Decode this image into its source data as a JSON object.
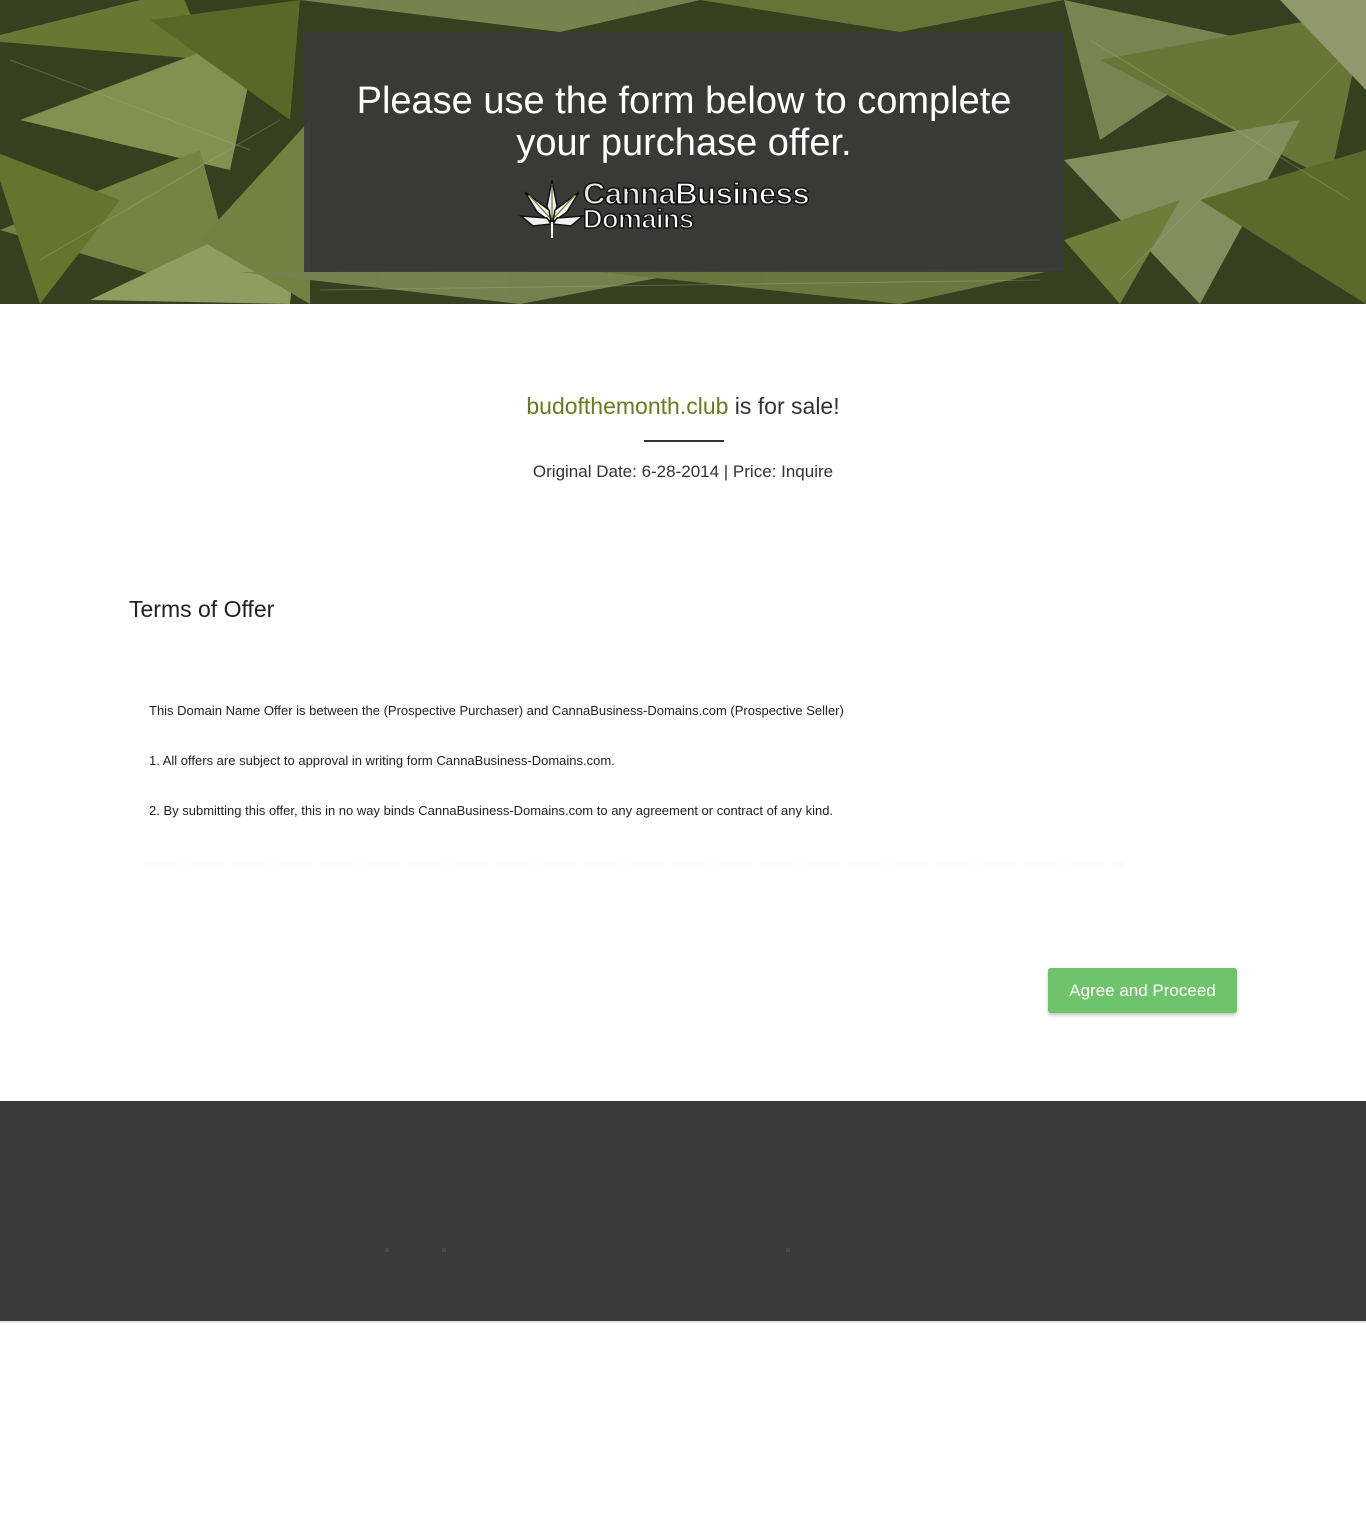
{
  "hero": {
    "heading": "Please use the form below to complete your purchase offer.",
    "logo": {
      "line1_part1": "Canna",
      "line1_part2": "Business",
      "line2": "Domains",
      "icon": "cannabis-leaf-icon"
    }
  },
  "listing": {
    "domain": "budofthemonth.club",
    "suffix": " is for sale!",
    "meta": "Original Date: 6-28-2014 | Price: Inquire"
  },
  "terms": {
    "title": "Terms of Offer",
    "lines": [
      "This Domain Name Offer is between the (Prospective Purchaser) and CannaBusiness-Domains.com (Prospective Seller)",
      "1. All offers are subject to approval in writing form CannaBusiness-Domains.com.",
      "2. By submitting this offer, this in no way binds CannaBusiness-Domains.com to any agreement or contract of any kind."
    ]
  },
  "actions": {
    "agree_label": "Agree and Proceed"
  },
  "colors": {
    "accent_green": "#6fc36b",
    "domain_green": "#6b7a1e",
    "footer_bg": "#3b3b3b",
    "hero_box_bg": "#3a3a3a"
  }
}
